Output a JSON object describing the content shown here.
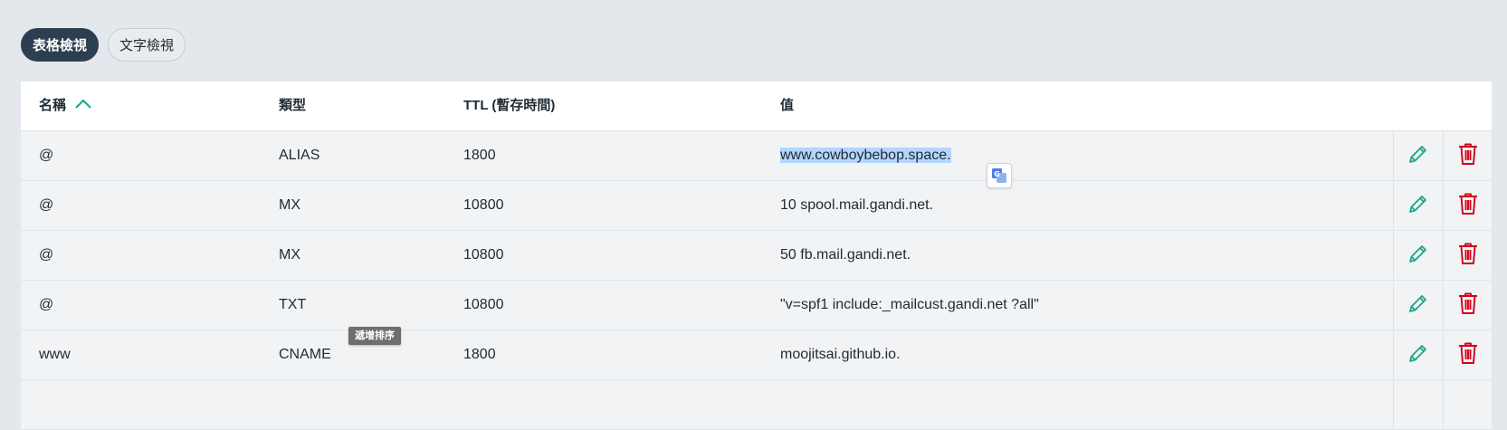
{
  "view_toggle": {
    "table_view": "表格檢視",
    "text_view": "文字檢視"
  },
  "table": {
    "headers": {
      "name": "名稱",
      "type": "類型",
      "ttl": "TTL (暫存時間)",
      "value": "值"
    },
    "sort": {
      "column": "name",
      "direction": "ascending",
      "icon": "chevron-up-icon"
    },
    "rows": [
      {
        "name": "@",
        "type": "ALIAS",
        "ttl": "1800",
        "value": "www.cowboybebop.space."
      },
      {
        "name": "@",
        "type": "MX",
        "ttl": "10800",
        "value": "10 spool.mail.gandi.net."
      },
      {
        "name": "@",
        "type": "MX",
        "ttl": "10800",
        "value": "50 fb.mail.gandi.net."
      },
      {
        "name": "@",
        "type": "TXT",
        "ttl": "10800",
        "value": "\"v=spf1 include:_mailcust.gandi.net ?all\""
      },
      {
        "name": "www",
        "type": "CNAME",
        "ttl": "1800",
        "value": "moojitsai.github.io."
      }
    ]
  },
  "tooltip": {
    "text": "遞增排序"
  },
  "icons": {
    "edit": "pencil-icon",
    "delete": "trash-icon",
    "translate": "google-translate-icon"
  },
  "colors": {
    "accent": "#1aa58a",
    "danger": "#d0021b",
    "active_toggle": "#2d3e50",
    "selection": "#b4d5fe"
  }
}
